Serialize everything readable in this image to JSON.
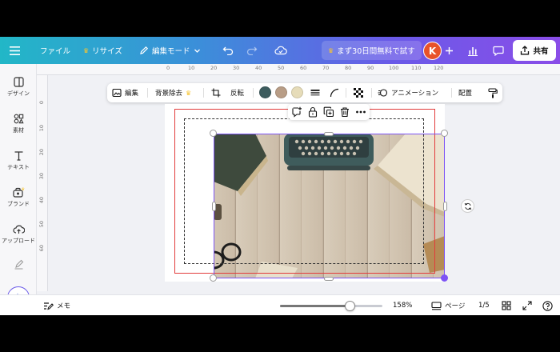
{
  "topbar": {
    "file_label": "ファイル",
    "resize_label": "リサイズ",
    "edit_mode_label": "編集モード",
    "trial_label": "まず30日間無料で試す",
    "avatar_initial": "K",
    "share_label": "共有"
  },
  "sidebar": {
    "items": [
      {
        "label": "デザイン",
        "icon": "layout-icon"
      },
      {
        "label": "素材",
        "icon": "shapes-icon"
      },
      {
        "label": "テキスト",
        "icon": "text-icon"
      },
      {
        "label": "ブランド",
        "icon": "brand-icon"
      },
      {
        "label": "アップロード",
        "icon": "cloud-upload-icon"
      }
    ]
  },
  "rulers": {
    "top": [
      "0",
      "10",
      "20",
      "30",
      "40",
      "50",
      "60",
      "70",
      "80",
      "90",
      "100",
      "110",
      "120"
    ],
    "left": [
      "0",
      "10",
      "20",
      "30",
      "40",
      "50",
      "60"
    ]
  },
  "context_toolbar": {
    "edit_label": "編集",
    "bg_remove_label": "背景除去",
    "flip_label": "反転",
    "animation_label": "アニメーション",
    "position_label": "配置",
    "swatch_colors": [
      "#3d5c5e",
      "#b89d86",
      "#e6dcb9"
    ]
  },
  "bottombar": {
    "notes_label": "メモ",
    "zoom_percent": "158%",
    "zoom_fraction": 0.68,
    "pages_label": "ページ",
    "page_counter": "1/5"
  },
  "colors": {
    "accent": "#7d53f5",
    "guide_red": "#e23b3b"
  }
}
